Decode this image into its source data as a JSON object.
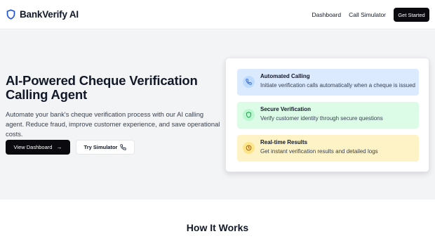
{
  "brand": {
    "name": "BankVerify AI",
    "icon": "shield-icon"
  },
  "nav": {
    "links": [
      "Dashboard",
      "Call Simulator"
    ],
    "cta_label": "Get Started"
  },
  "hero": {
    "title": "AI-Powered Cheque Verification Calling Agent",
    "description": "Automate your bank's cheque verification process with our AI calling agent. Reduce fraud, improve customer experience, and save operational costs.",
    "primary_button": {
      "label": "View Dashboard",
      "icon": "arrow-right-icon"
    },
    "secondary_button": {
      "label": "Try Simulator",
      "icon": "phone-icon"
    }
  },
  "features": [
    {
      "title": "Automated Calling",
      "description": "Initiate verification calls automatically when a cheque is issued",
      "icon": "phone-icon",
      "color": "#dbeafe"
    },
    {
      "title": "Secure Verification",
      "description": "Verify customer identity through secure questions",
      "icon": "shield-icon",
      "color": "#dcfce7"
    },
    {
      "title": "Real-time Results",
      "description": "Get instant verification results and detailed logs",
      "icon": "clock-icon",
      "color": "#fef3c7"
    }
  ],
  "section": {
    "heading": "How It Works"
  },
  "colors": {
    "primary": "#0b0b0f",
    "brand_icon": "#1d4ed8",
    "hero_bg": "#f3f4f6",
    "phone_icon": "#2563eb",
    "shield_icon": "#16a34a",
    "clock_icon": "#b45309"
  }
}
